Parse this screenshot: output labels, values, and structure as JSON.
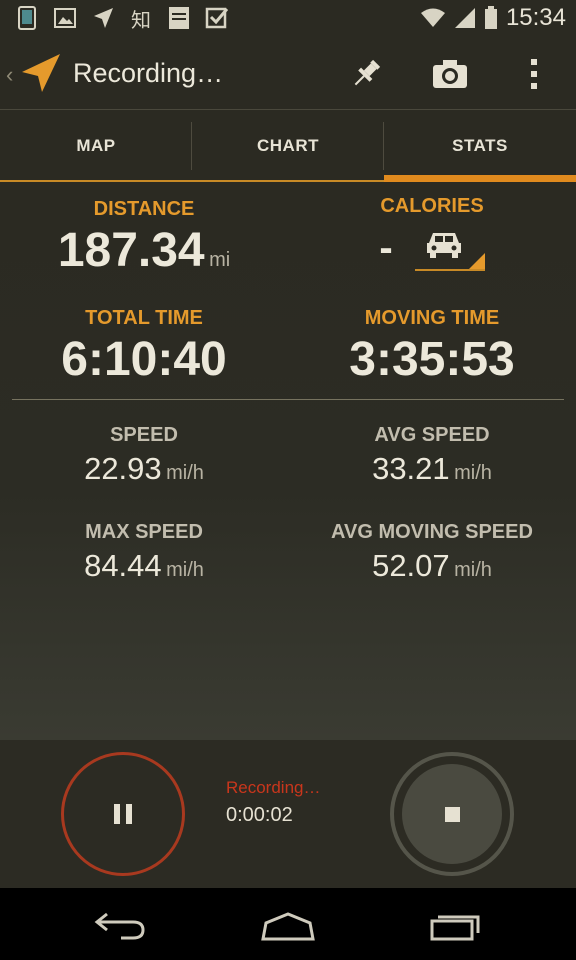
{
  "status_bar": {
    "time": "15:34",
    "left_icons": [
      "phone-icon",
      "image-icon",
      "navigation-icon",
      "zhihu-icon",
      "bible-icon",
      "checkbox-icon"
    ],
    "right_icons": [
      "wifi-icon",
      "signal-icon",
      "battery-icon"
    ],
    "zhihu_glyph": "知"
  },
  "action_bar": {
    "title": "Recording…",
    "actions": [
      "pin-icon",
      "camera-icon",
      "overflow-menu-icon"
    ]
  },
  "tabs": [
    {
      "label": "MAP",
      "active": false
    },
    {
      "label": "CHART",
      "active": false
    },
    {
      "label": "STATS",
      "active": true
    }
  ],
  "stats": {
    "distance": {
      "label": "DISTANCE",
      "value": "187.34",
      "unit": "mi"
    },
    "calories": {
      "label": "CALORIES",
      "value": "-",
      "activity_icon": "car-icon"
    },
    "total_time": {
      "label": "TOTAL TIME",
      "value": "6:10:40"
    },
    "moving_time": {
      "label": "MOVING TIME",
      "value": "3:35:53"
    },
    "speed": {
      "label": "SPEED",
      "value": "22.93",
      "unit": "mi/h"
    },
    "avg_speed": {
      "label": "AVG SPEED",
      "value": "33.21",
      "unit": "mi/h"
    },
    "max_speed": {
      "label": "MAX SPEED",
      "value": "84.44",
      "unit": "mi/h"
    },
    "avg_moving_speed": {
      "label": "AVG MOVING SPEED",
      "value": "52.07",
      "unit": "mi/h"
    }
  },
  "controls": {
    "status_label": "Recording…",
    "elapsed": "0:00:02"
  },
  "colors": {
    "accent_orange": "#e59a2c",
    "recording_red": "#c9361c",
    "background": "#2b2a22"
  }
}
